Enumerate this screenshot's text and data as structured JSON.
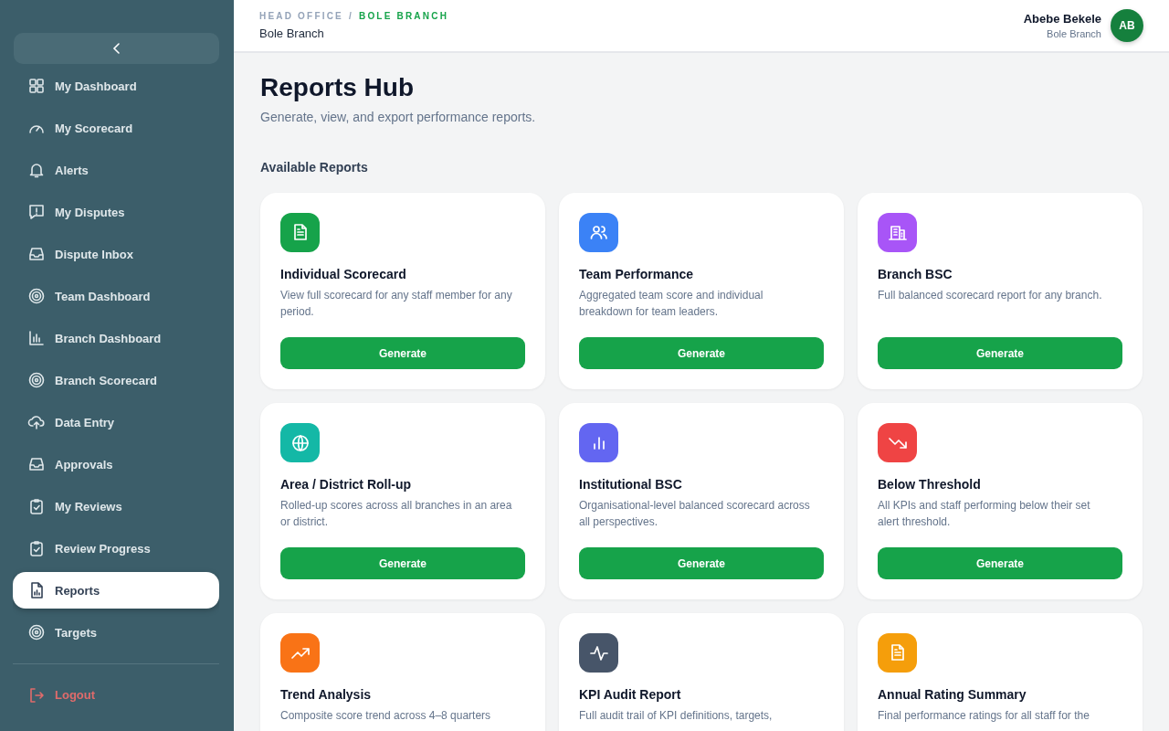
{
  "sidebar": {
    "items": [
      {
        "label": "My Dashboard",
        "selected": false
      },
      {
        "label": "My Scorecard",
        "selected": false
      },
      {
        "label": "Alerts",
        "selected": false
      },
      {
        "label": "My Disputes",
        "selected": false
      },
      {
        "label": "Dispute Inbox",
        "selected": false
      },
      {
        "label": "Team Dashboard",
        "selected": false
      },
      {
        "label": "Branch Dashboard",
        "selected": false
      },
      {
        "label": "Branch Scorecard",
        "selected": false
      },
      {
        "label": "Data Entry",
        "selected": false
      },
      {
        "label": "Approvals",
        "selected": false
      },
      {
        "label": "My Reviews",
        "selected": false
      },
      {
        "label": "Review Progress",
        "selected": false
      },
      {
        "label": "Reports",
        "selected": true
      },
      {
        "label": "Targets",
        "selected": false
      }
    ],
    "logout": "Logout"
  },
  "header": {
    "breadcrumb": [
      "HEAD OFFICE",
      "BOLE BRANCH"
    ],
    "separator": "/",
    "subtitle": "Bole Branch",
    "user": {
      "name": "Abebe Bekele",
      "branch": "Bole Branch",
      "initials": "AB"
    }
  },
  "page": {
    "title": "Reports Hub",
    "subtitle": "Generate, view, and export performance reports.",
    "section": "Available Reports"
  },
  "reports": [
    {
      "title": "Individual Scorecard",
      "description": "View full scorecard for any staff member for any period.",
      "color": "#16a34a",
      "button": "Generate"
    },
    {
      "title": "Team Performance",
      "description": "Aggregated team score and individual breakdown for team leaders.",
      "color": "#3b82f6",
      "button": "Generate"
    },
    {
      "title": "Branch BSC",
      "description": "Full balanced scorecard report for any branch.",
      "color": "#a855f7",
      "button": "Generate"
    },
    {
      "title": "Area / District Roll-up",
      "description": "Rolled-up scores across all branches in an area or district.",
      "color": "#14b8a6",
      "button": "Generate"
    },
    {
      "title": "Institutional BSC",
      "description": "Organisational-level balanced scorecard across all perspectives.",
      "color": "#6366f1",
      "button": "Generate"
    },
    {
      "title": "Below Threshold",
      "description": "All KPIs and staff performing below their set alert threshold.",
      "color": "#ef4444",
      "button": "Generate"
    },
    {
      "title": "Trend Analysis",
      "description": "Composite score trend across 4–8 quarters",
      "color": "#f97316"
    },
    {
      "title": "KPI Audit Report",
      "description": "Full audit trail of KPI definitions, targets,",
      "color": "#475569"
    },
    {
      "title": "Annual Rating Summary",
      "description": "Final performance ratings for all staff for the",
      "color": "#f59e0b"
    }
  ]
}
